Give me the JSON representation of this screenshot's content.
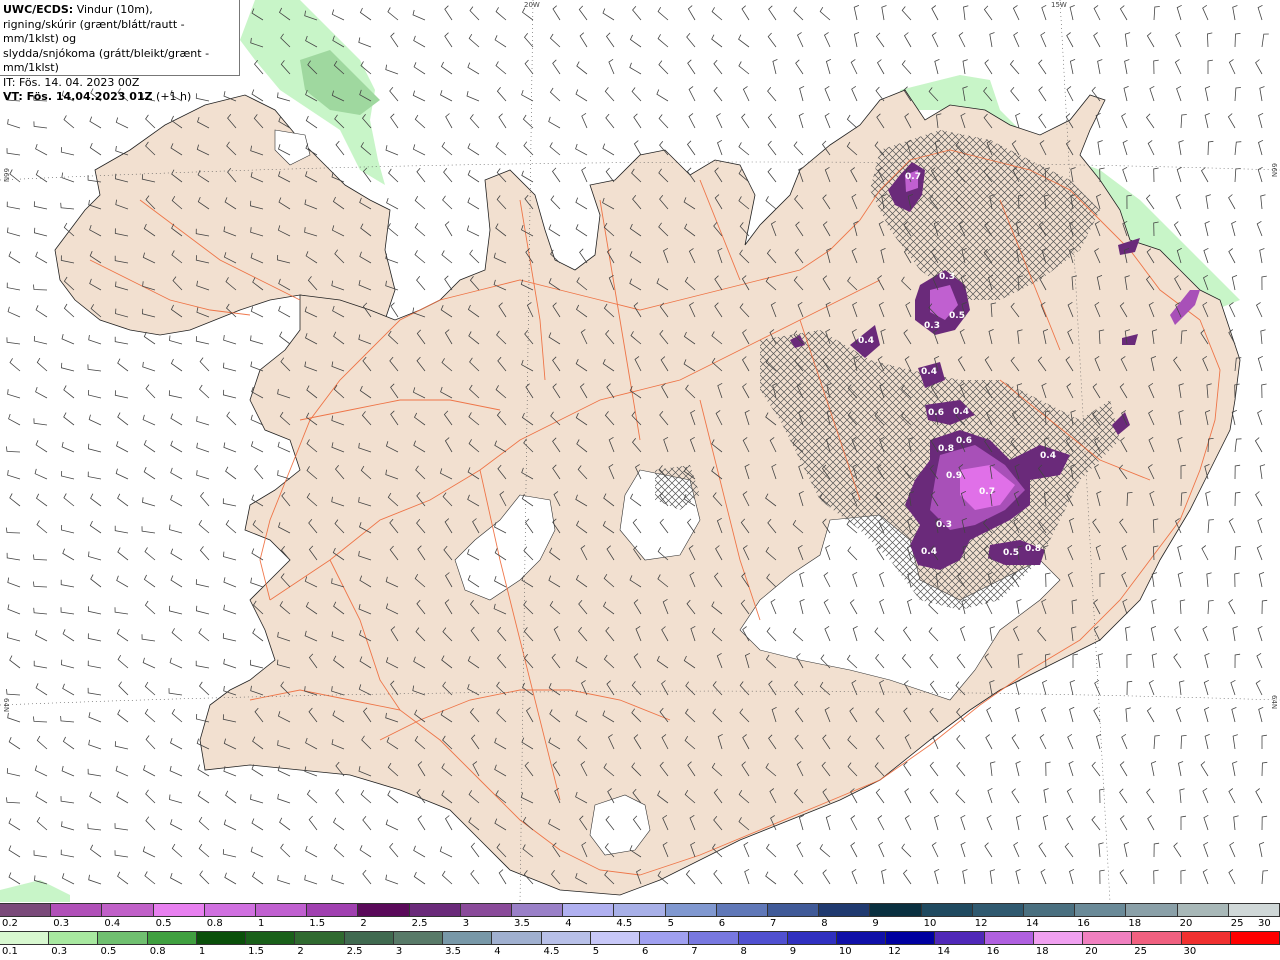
{
  "info": {
    "line1_bold": "UWC/ECDS:",
    "line1_rest": " Vindur (10m),",
    "line2": "rigning/skúrir (grænt/blátt/rautt - mm/1klst) og",
    "line3": "slydda/snjókoma (grátt/bleikt/grænt - mm/1klst)",
    "line4": "IT: Fös. 14. 04. 2023 00Z",
    "line5_bold": "VT: Fös. 14.04.2023 01Z",
    "line5_rest": " (+1 h)"
  },
  "graticule": {
    "top_20w": "20W",
    "top_15w": "15W",
    "left_66n": "66N",
    "left_64n": "64N",
    "right_66n": "66N",
    "right_64n": "64N"
  },
  "colors": {
    "land": "#f2e0d0",
    "sea": "#ffffff",
    "roads": "#ee6a3a",
    "glacier": "#ffffff",
    "rain_light": "#c8f5c8",
    "rain_mid": "#9fd89f",
    "snow_dark": "#6a2a7a",
    "snow_mid": "#a850b8",
    "snow_light": "#e070e8",
    "sleet_hatch": "#555555"
  },
  "precip_labels": [
    {
      "value": "0.7"
    },
    {
      "value": "0.3"
    },
    {
      "value": "0.5"
    },
    {
      "value": "0.3"
    },
    {
      "value": "0.4"
    },
    {
      "value": "0.4"
    },
    {
      "value": "0.6"
    },
    {
      "value": "0.4"
    },
    {
      "value": "0.6"
    },
    {
      "value": "0.8"
    },
    {
      "value": "0.9"
    },
    {
      "value": "0.7"
    },
    {
      "value": "0.4"
    },
    {
      "value": "0.3"
    },
    {
      "value": "0.4"
    },
    {
      "value": "0.5"
    },
    {
      "value": "0.8"
    }
  ],
  "legend_top": {
    "labels": [
      "0.2",
      "0.3",
      "0.4",
      "0.5",
      "0.8",
      "1",
      "1.5",
      "2",
      "2.5",
      "3",
      "3.5",
      "4",
      "4.5",
      "5",
      "6",
      "7",
      "8",
      "9",
      "10",
      "12",
      "14",
      "16",
      "18",
      "20",
      "25",
      "30"
    ],
    "colors": [
      "#7a4a7a",
      "#b050b8",
      "#c060c8",
      "#e880f0",
      "#d070e0",
      "#c060d0",
      "#a040b0",
      "#5a0a5a",
      "#6a2a7a",
      "#8a4a9a",
      "#9a80c8",
      "#b0b0f0",
      "#a8b0e8",
      "#8098d0",
      "#6078b8",
      "#405a98",
      "#203a70",
      "#0a3040",
      "#204a60",
      "#305a70",
      "#4a7080",
      "#6a8a98",
      "#8aa0a8",
      "#a8b8b8",
      "#d0d8d8"
    ]
  },
  "legend_bottom": {
    "labels": [
      "0.1",
      "0.3",
      "0.5",
      "0.8",
      "1",
      "1.5",
      "2",
      "2.5",
      "3",
      "3.5",
      "4",
      "4.5",
      "5",
      "6",
      "7",
      "8",
      "9",
      "10",
      "12",
      "14",
      "16",
      "18",
      "20",
      "25",
      "30"
    ],
    "colors": [
      "#d8f8d0",
      "#a8e8a0",
      "#70c070",
      "#40a040",
      "#0a500a",
      "#1a601a",
      "#306a30",
      "#406a50",
      "#587a68",
      "#7898a8",
      "#a0b0d0",
      "#b8c0e8",
      "#c8c8f8",
      "#a0a0f0",
      "#7878e0",
      "#5050d0",
      "#3030c0",
      "#1010a8",
      "#0000a0",
      "#5028b8",
      "#b060e0",
      "#f0a0f0",
      "#f080c0",
      "#f06080",
      "#f03030",
      "#ff0000"
    ]
  }
}
